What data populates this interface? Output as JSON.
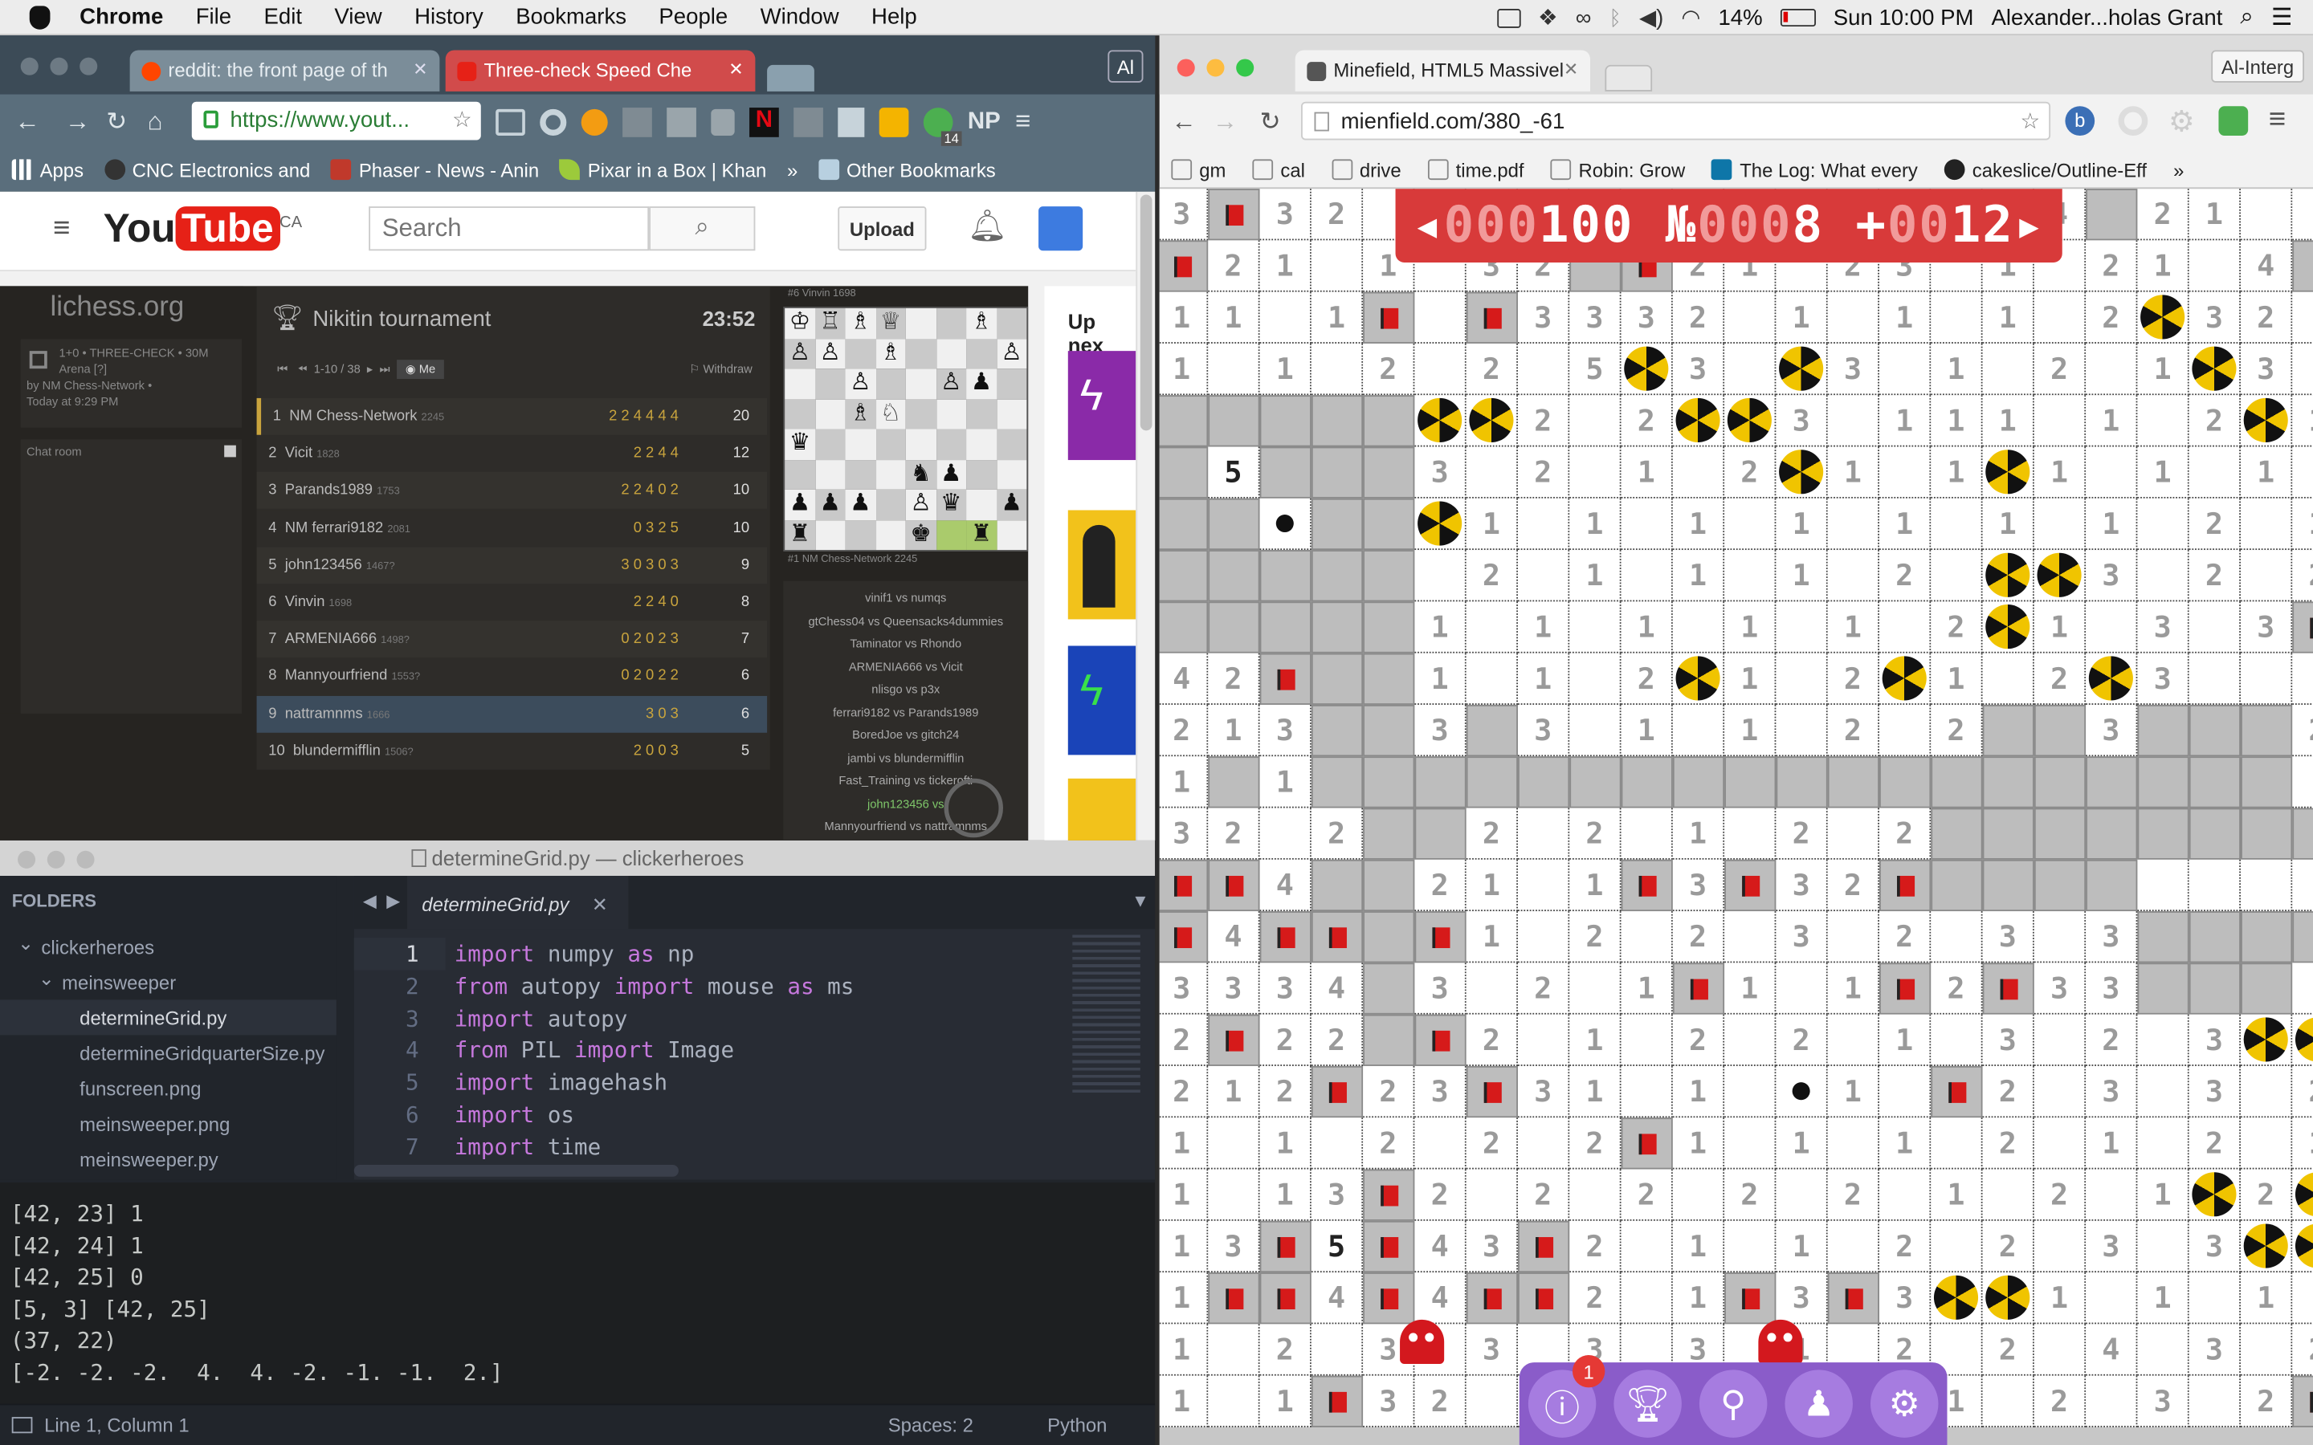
{
  "menubar": {
    "app": "Chrome",
    "items": [
      "File",
      "Edit",
      "View",
      "History",
      "Bookmarks",
      "People",
      "Window",
      "Help"
    ],
    "battery": "14%",
    "clock": "Sun 10:00 PM",
    "user": "Alexander...holas Grant"
  },
  "left_chrome": {
    "tabs": [
      {
        "title": "reddit: the front page of th"
      },
      {
        "title": "Three-check Speed Che"
      }
    ],
    "profile": "Al",
    "url": "https://www.yout...",
    "bookmarks": [
      "Apps",
      "CNC Electronics and",
      "Phaser - News - Anin",
      "Pixar in a Box | Khan",
      "»",
      "Other Bookmarks"
    ],
    "ext_badge": "14",
    "ext_np": "NP"
  },
  "youtube": {
    "logo": "You",
    "logo2": "Tube",
    "region": "CA",
    "search_placeholder": "Search",
    "upload": "Upload",
    "upnext": "Up nex"
  },
  "lichess": {
    "site": "lichess.org",
    "game_info": "1+0 • THREE-CHECK • 30M",
    "arena": "Arena [?]",
    "by": "by NM Chess-Network •",
    "when": "Today at 9:29 PM",
    "chat": "Chat room",
    "tournament": "Nikitin tournament",
    "clock": "23:52",
    "pager": "1-10 / 38",
    "me": "Me",
    "withdraw": "Withdraw",
    "standings": [
      {
        "rank": "1",
        "name": "NM Chess-Network",
        "rating": "2245",
        "scores": "2 2 4 4 4 4",
        "points": "20"
      },
      {
        "rank": "2",
        "name": "Vicit",
        "rating": "1828",
        "scores": "2 2 4 4",
        "points": "12"
      },
      {
        "rank": "3",
        "name": "Parands1989",
        "rating": "1753",
        "scores": "2 2 4 0 2",
        "points": "10"
      },
      {
        "rank": "4",
        "name": "NM ferrari9182",
        "rating": "2081",
        "scores": "0 3 2 5",
        "points": "10"
      },
      {
        "rank": "5",
        "name": "john123456",
        "rating": "1467?",
        "scores": "3 0 3 0 3",
        "points": "9"
      },
      {
        "rank": "6",
        "name": "Vinvin",
        "rating": "1698",
        "scores": "2 2 4 0",
        "points": "8"
      },
      {
        "rank": "7",
        "name": "ARMENIA666",
        "rating": "1498?",
        "scores": "0 2 0 2 3",
        "points": "7"
      },
      {
        "rank": "8",
        "name": "Mannyourfriend",
        "rating": "1553?",
        "scores": "0 2 0 2 2",
        "points": "6"
      },
      {
        "rank": "9",
        "name": "nattramnms",
        "rating": "1666",
        "scores": "3 0 3",
        "points": "6"
      },
      {
        "rank": "10",
        "name": "blundermifflin",
        "rating": "1506?",
        "scores": "2 0 0 3",
        "points": "5"
      }
    ],
    "board_top": "#6   Vinvin 1698",
    "board_bottom": "#1   NM Chess-Network 2245",
    "games": [
      "vinif1 vs numqs",
      "gtChess04 vs Queensacks4dummies",
      "Taminator vs Rhondo",
      "ARMENIA666 vs Vicit",
      "nlisgo vs p3x",
      "ferrari9182 vs Parands1989",
      "BoredJoe vs gitch24",
      "jambi vs blundermifflin",
      "Fast_Training vs tickerofti",
      "john123456 vs",
      "Mannyourfriend vs nattramnms"
    ]
  },
  "atom": {
    "title": "determineGrid.py — clickerheroes",
    "folders_label": "FOLDERS",
    "tree": [
      {
        "name": "clickerheroes",
        "indent": 1,
        "kind": "folder"
      },
      {
        "name": "meinsweeper",
        "indent": 2,
        "kind": "folder"
      },
      {
        "name": "determineGrid.py",
        "indent": 3,
        "kind": "file",
        "active": true
      },
      {
        "name": "determineGridquarterSize.py",
        "indent": 3,
        "kind": "file"
      },
      {
        "name": "funscreen.png",
        "indent": 3,
        "kind": "file"
      },
      {
        "name": "meinsweeper.png",
        "indent": 3,
        "kind": "file"
      },
      {
        "name": "meinsweeper.py",
        "indent": 3,
        "kind": "file"
      }
    ],
    "tab": "determineGrid.py",
    "code": [
      [
        [
          "import",
          "kw"
        ],
        [
          " numpy ",
          ""
        ],
        [
          "as",
          "kw"
        ],
        [
          " np",
          ""
        ]
      ],
      [
        [
          "from",
          "kw"
        ],
        [
          " autopy ",
          ""
        ],
        [
          "import",
          "kw"
        ],
        [
          " mouse ",
          ""
        ],
        [
          "as",
          "kw"
        ],
        [
          " ms",
          ""
        ]
      ],
      [
        [
          "import",
          "kw"
        ],
        [
          " autopy",
          ""
        ]
      ],
      [
        [
          "from",
          "kw"
        ],
        [
          " PIL ",
          ""
        ],
        [
          "import",
          "kw"
        ],
        [
          " Image",
          ""
        ]
      ],
      [
        [
          "import",
          "kw"
        ],
        [
          " imagehash",
          ""
        ]
      ],
      [
        [
          "import",
          "kw"
        ],
        [
          " os",
          ""
        ]
      ],
      [
        [
          "import",
          "kw"
        ],
        [
          " time",
          ""
        ]
      ]
    ],
    "console": [
      "[42, 23] 1",
      "[42, 24] 1",
      "[42, 25] 0",
      "[5, 3] [42, 25]",
      "(37, 22)",
      "[-2. -2. -2.  4.  4. -2. -1. -1.  2.]"
    ],
    "status_left": "Line 1, Column 1",
    "status_spaces": "Spaces: 2",
    "status_lang": "Python"
  },
  "right_chrome": {
    "tab": "Minefield, HTML5 Massivel",
    "profile": "Al-Interg",
    "url": "mienfield.com/380_-61",
    "bookmarks": [
      "gm",
      "cal",
      "drive",
      "time.pdf",
      "Robin: Grow",
      "The Log: What every",
      "cakeslice/Outline-Eff",
      "»"
    ]
  },
  "minefield": {
    "counter": {
      "arrow_left": "◂",
      "lead1": "000",
      "val1": "100",
      "sign": " №",
      "lead2": "000",
      "val2": "8",
      "plus": " +",
      "lead3": "00",
      "val3": "12",
      "arrow_right": "▸"
    },
    "dock_badge": "1",
    "dock_icons": [
      "info-icon",
      "trophy-icon",
      "map-pin-icon",
      "user-icon",
      "settings-icon"
    ],
    "grid": [
      "3F32 1 1 3332 21 4?21",
      "F21 1 32?F21 23 1 21 4?3 1",
      "11 1F F3332 1 1 1 2M32 2",
      "1 1 2 2 5M3 M3 1 2 1M3 21 2",
      "?????MM2 2MM3 111 1 2M1 ",
      "?5???3 2 1 2M1 1M1 1 1 2 ",
      "??.??M1 1 1 1 1 1 1 2 1 1 2",
      "????? 2 1 1 1 2 MM3 2 2 ",
      "?????1 1 1 1 1 2M1 3 3F 3 3",
      "42F??1 1 2M1 2M1 2M3 ",
      "213??3?3 1 1 2 2??3???2",
      "1?1???????????????????",
      "32 2??2 2 1 2 2????????",
      "FF4??21 1F3F32F????",
      "F4FF?F1 2 2 3 2 3 3????",
      "3334?3 2 1F1 1F2F33???",
      "2F22?F2 1 2 2 1 3 2 3MM2 2 2",
      "212F23F31 1 .1 F2 3 3 2 ",
      "1 1 2 2 2F1 1 1 2 1 2 1 2M1 ",
      "1 13F2 2 2 2 2 1 2 1M2M1 2 1 ",
      "13F5F43F2 1 1 2 2 3 3MM2 1 2M1",
      "1FF4F4FF2 1F3F3MM1 1 1 1 1",
      "1 2 3 3 3G3 1 2 2 4G3 2 3 2 2 ",
      "1 1F32 1 2 1 2 1 2 3 2F1 1 2 "
    ],
    "counter_label": "counter"
  }
}
